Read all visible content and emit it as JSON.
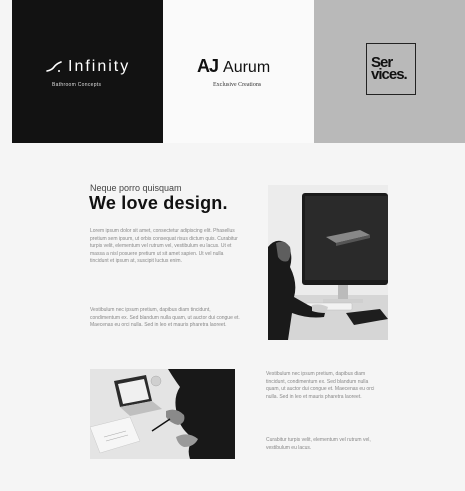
{
  "brands": {
    "infinity": {
      "name": "Infinity",
      "tagline": "Bathroom Concepts",
      "mark_icon": "slash-swoosh-icon"
    },
    "aurum": {
      "mark": "AJ",
      "name": "Aurum",
      "tagline": "Exclusive Creations"
    },
    "services": {
      "text": "Ser vices."
    }
  },
  "article": {
    "kicker": "Neque porro quisquam",
    "headline": "We love design.",
    "paragraph_1": "Lorem ipsum dolor sit amet, consectetur adipiscing elit. Phasellus pretium sem ipsum, ut orbis consequat risus dictum quis. Curabitur turpis velit, elementum vel rutrum vel, vestibulum eu lacus. Ut et massa a nisl posuere pretium ut sit amet sapien. Ut vel nulla tincidunt et ipsum at, suscipit luctus enim.",
    "paragraph_2": "Vestibulum nec ipsum pretium, dapibus diam tincidunt, condimentum ex. Sed blandum nulla quam, ut auctor dui congue et. Maecenas eu orci nulla. Sed in leo et mauris pharetra laoreet.",
    "paragraph_3": "Vestibulum nec ipsum pretium, dapibus diam tincidunt, condimentum ex. Sed blandum nulla quam, ut auctor dui congue et. Maecenas eu orci nulla. Sed in leo et mauris pharetra laoreet.",
    "paragraph_4": "Curabitur turpis velit, elementum vel rutrum vel, vestibulum eu lacus."
  },
  "colors": {
    "dark_tile": "#121212",
    "light_tile": "#fafafa",
    "gray_tile": "#b9b9b9",
    "page_background": "#f5f5f5"
  }
}
